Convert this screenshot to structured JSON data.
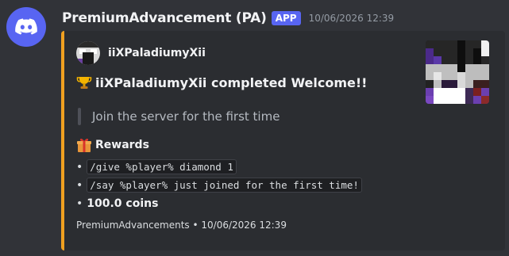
{
  "message": {
    "author": "PremiumAdvancement (PA)",
    "badge": "APP",
    "timestamp": "10/06/2026 12:39",
    "avatar_icon": "discord-logo-icon"
  },
  "embed": {
    "accent_color": "#f0a020",
    "author_name": "iiXPaladiumyXii",
    "title_prefix": "iiXPaladiumyXii completed ",
    "title_target": "Welcome!!",
    "title_icon": "trophy-icon",
    "description": "Join the server for the first time",
    "field": {
      "name": "Rewards",
      "icon": "gift-icon",
      "items": [
        {
          "bullet": "•",
          "text": "/give %player% diamond 1",
          "code": true
        },
        {
          "bullet": "•",
          "text": "/say %player% just joined for the first time!",
          "code": true
        },
        {
          "bullet": "•",
          "text": "100.0 coins",
          "code": false
        }
      ]
    },
    "footer": "PremiumAdvancements • 10/06/2026 12:39"
  }
}
